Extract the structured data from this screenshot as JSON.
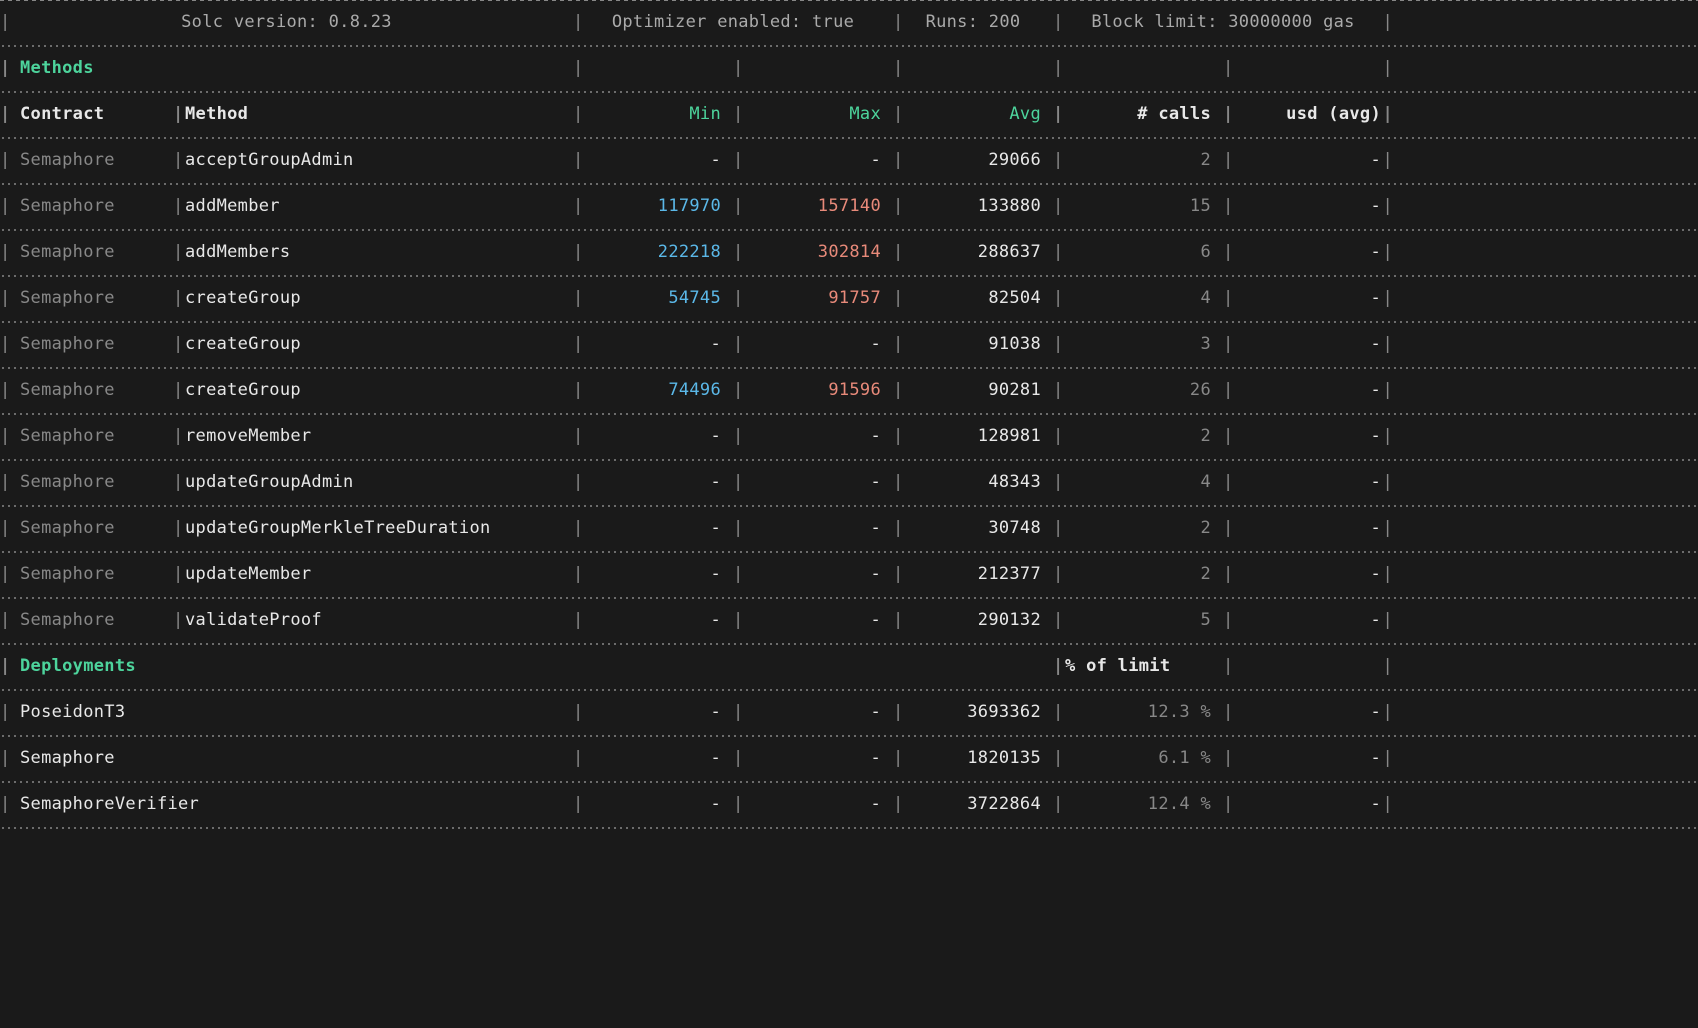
{
  "info": {
    "solc_label": "Solc version: 0.8.23",
    "optimizer_label": "Optimizer enabled: true",
    "runs_label": "Runs: 200",
    "block_limit_label": "Block limit: 30000000 gas"
  },
  "sections": {
    "methods_label": "Methods",
    "deployments_label": "Deployments",
    "pct_limit_header": "% of limit"
  },
  "headers": {
    "contract": "Contract",
    "method": "Method",
    "min": "Min",
    "max": "Max",
    "avg": "Avg",
    "calls": "# calls",
    "usd": "usd (avg)"
  },
  "methods": [
    {
      "contract": "Semaphore",
      "method": "acceptGroupAdmin",
      "min": "-",
      "max": "-",
      "avg": "29066",
      "calls": "2",
      "usd": "-"
    },
    {
      "contract": "Semaphore",
      "method": "addMember",
      "min": "117970",
      "max": "157140",
      "avg": "133880",
      "calls": "15",
      "usd": "-"
    },
    {
      "contract": "Semaphore",
      "method": "addMembers",
      "min": "222218",
      "max": "302814",
      "avg": "288637",
      "calls": "6",
      "usd": "-"
    },
    {
      "contract": "Semaphore",
      "method": "createGroup",
      "min": "54745",
      "max": "91757",
      "avg": "82504",
      "calls": "4",
      "usd": "-"
    },
    {
      "contract": "Semaphore",
      "method": "createGroup",
      "min": "-",
      "max": "-",
      "avg": "91038",
      "calls": "3",
      "usd": "-"
    },
    {
      "contract": "Semaphore",
      "method": "createGroup",
      "min": "74496",
      "max": "91596",
      "avg": "90281",
      "calls": "26",
      "usd": "-"
    },
    {
      "contract": "Semaphore",
      "method": "removeMember",
      "min": "-",
      "max": "-",
      "avg": "128981",
      "calls": "2",
      "usd": "-"
    },
    {
      "contract": "Semaphore",
      "method": "updateGroupAdmin",
      "min": "-",
      "max": "-",
      "avg": "48343",
      "calls": "4",
      "usd": "-"
    },
    {
      "contract": "Semaphore",
      "method": "updateGroupMerkleTreeDuration",
      "min": "-",
      "max": "-",
      "avg": "30748",
      "calls": "2",
      "usd": "-"
    },
    {
      "contract": "Semaphore",
      "method": "updateMember",
      "min": "-",
      "max": "-",
      "avg": "212377",
      "calls": "2",
      "usd": "-"
    },
    {
      "contract": "Semaphore",
      "method": "validateProof",
      "min": "-",
      "max": "-",
      "avg": "290132",
      "calls": "5",
      "usd": "-"
    }
  ],
  "deployments": [
    {
      "name": "PoseidonT3",
      "min": "-",
      "max": "-",
      "avg": "3693362",
      "pct": "12.3 %",
      "usd": "-"
    },
    {
      "name": "Semaphore",
      "min": "-",
      "max": "-",
      "avg": "1820135",
      "pct": "6.1 %",
      "usd": "-"
    },
    {
      "name": "SemaphoreVerifier",
      "min": "-",
      "max": "-",
      "avg": "3722864",
      "pct": "12.4 %",
      "usd": "-"
    }
  ]
}
